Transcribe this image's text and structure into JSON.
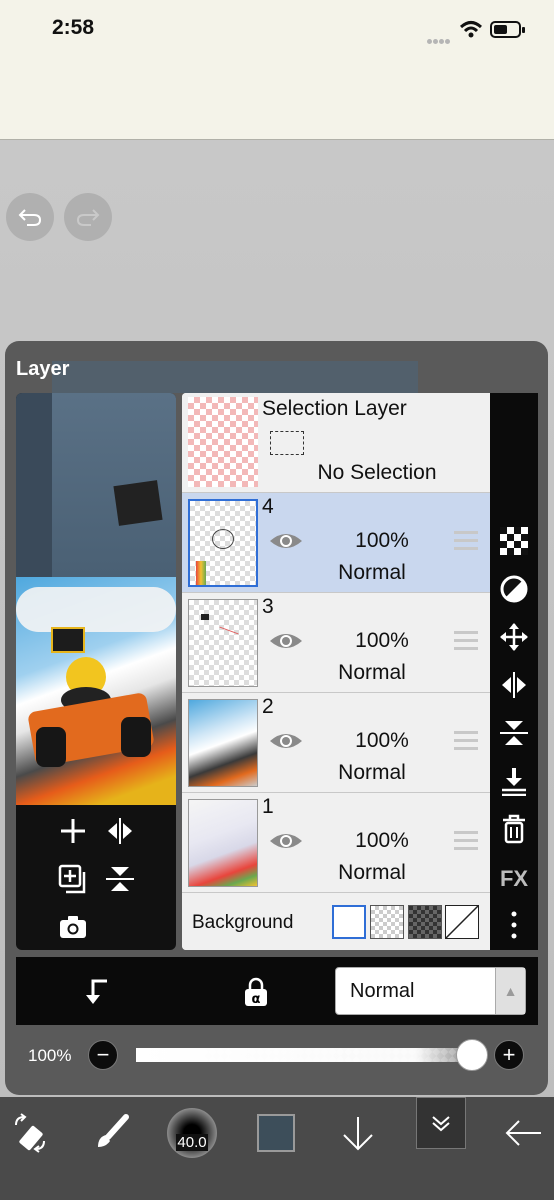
{
  "status": {
    "time": "2:58"
  },
  "panel": {
    "title": "Layer"
  },
  "selection_layer": {
    "title": "Selection Layer",
    "state": "No Selection"
  },
  "layers": [
    {
      "number": "4",
      "opacity": "100%",
      "mode": "Normal",
      "selected": true
    },
    {
      "number": "3",
      "opacity": "100%",
      "mode": "Normal",
      "selected": false
    },
    {
      "number": "2",
      "opacity": "100%",
      "mode": "Normal",
      "selected": false
    },
    {
      "number": "1",
      "opacity": "100%",
      "mode": "Normal",
      "selected": false
    }
  ],
  "background": {
    "label": "Background",
    "options": [
      "white",
      "transparent-light",
      "transparent-dark",
      "none"
    ],
    "selected": "white"
  },
  "right_tools": {
    "fx_label": "FX"
  },
  "blend": {
    "value": "Normal"
  },
  "opacity": {
    "label": "100%",
    "value": 1.0
  },
  "toolbar": {
    "brush_size": "40.0",
    "color": "#3d4e5a"
  },
  "colors": {
    "selected_row": "#c9d7ee",
    "accent": "#2f6ed6"
  }
}
